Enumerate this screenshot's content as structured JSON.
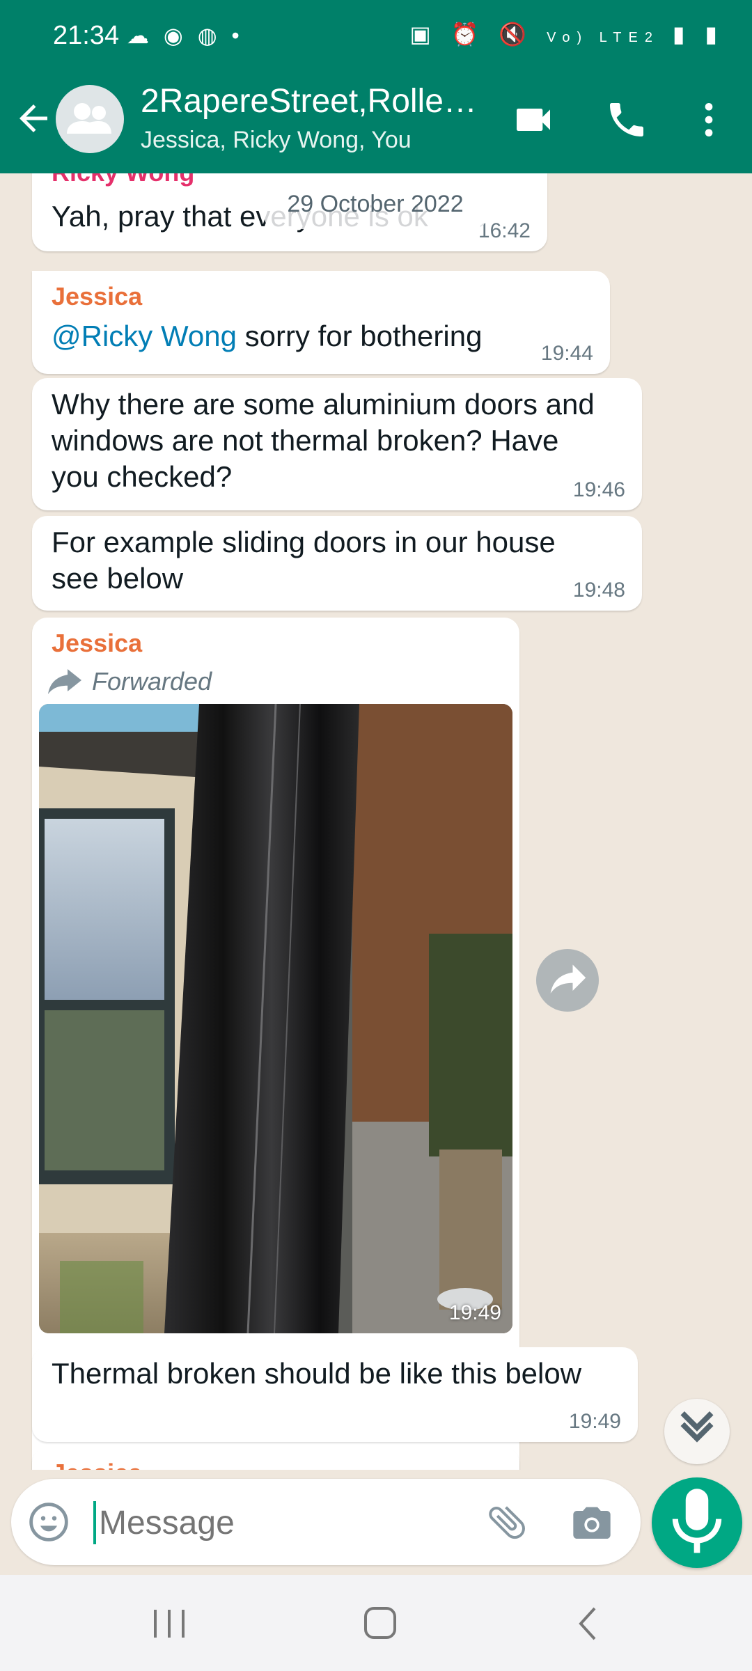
{
  "status_bar": {
    "time": "21:34",
    "network": "Vo) LTE2"
  },
  "header": {
    "title": "2RapereStreet,Rolle…",
    "subtitle": "Jessica, Ricky Wong, You",
    "accent_color": "#008069"
  },
  "chat": {
    "date_chip": "29 October 2022",
    "messages": [
      {
        "sender": "Ricky Wong",
        "text": "Yah, pray that everyone is ok",
        "time": "16:42",
        "sender_color": "#e5306b"
      },
      {
        "sender": "Jessica",
        "mention": "@Ricky Wong",
        "text": " sorry for bothering",
        "time": "19:44",
        "sender_color": "#e9703a"
      },
      {
        "text": "Why there are some aluminium doors and windows are not thermal broken? Have you checked?",
        "time": "19:46"
      },
      {
        "text": "For example sliding doors in our house see below",
        "time": "19:48"
      },
      {
        "sender": "Jessica",
        "forwarded_label": "Forwarded",
        "time": "19:49",
        "icon": "image"
      },
      {
        "text": "Thermal broken should be like this below",
        "time": "19:49"
      },
      {
        "sender": "Jessica"
      }
    ]
  },
  "input": {
    "placeholder": "Message"
  },
  "icons": [
    "back-arrow-icon",
    "group-avatar-icon",
    "video-call-icon",
    "phone-icon",
    "more-vert-icon",
    "forward-icon",
    "scroll-down-icon",
    "emoji-icon",
    "attach-icon",
    "camera-icon",
    "mic-icon"
  ]
}
